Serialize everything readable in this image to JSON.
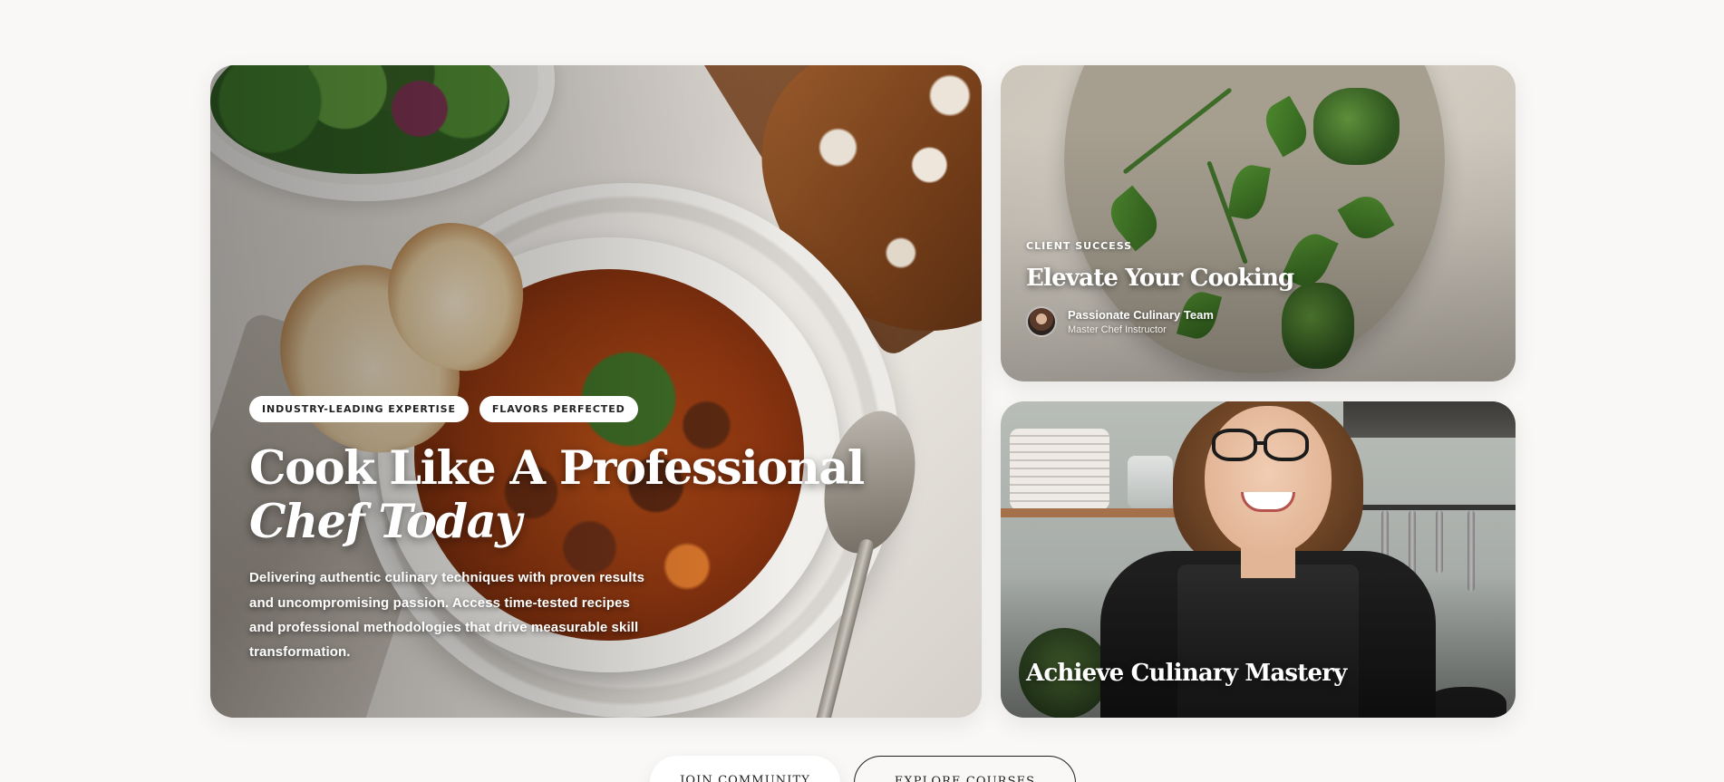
{
  "hero": {
    "tags": [
      "INDUSTRY-LEADING EXPERTISE",
      "FLAVORS PERFECTED"
    ],
    "title_line1": "Cook Like A Professional",
    "title_line2": "Chef Today",
    "description": "Delivering authentic culinary techniques with proven results and uncompromising passion. Access time-tested recipes and professional methodologies that drive measurable skill transformation."
  },
  "card_top": {
    "eyebrow": "CLIENT SUCCESS",
    "title": "Elevate Your Cooking",
    "author_name": "Passionate Culinary Team",
    "author_role": "Master Chef Instructor"
  },
  "card_bottom": {
    "title": "Achieve Culinary Mastery"
  },
  "cta": {
    "primary_label": "JOIN COMMUNITY",
    "secondary_label": "EXPLORE COURSES"
  },
  "colors": {
    "background": "#f9f8f6",
    "text_light": "#ffffff",
    "text_dark": "#1f1f1f"
  }
}
